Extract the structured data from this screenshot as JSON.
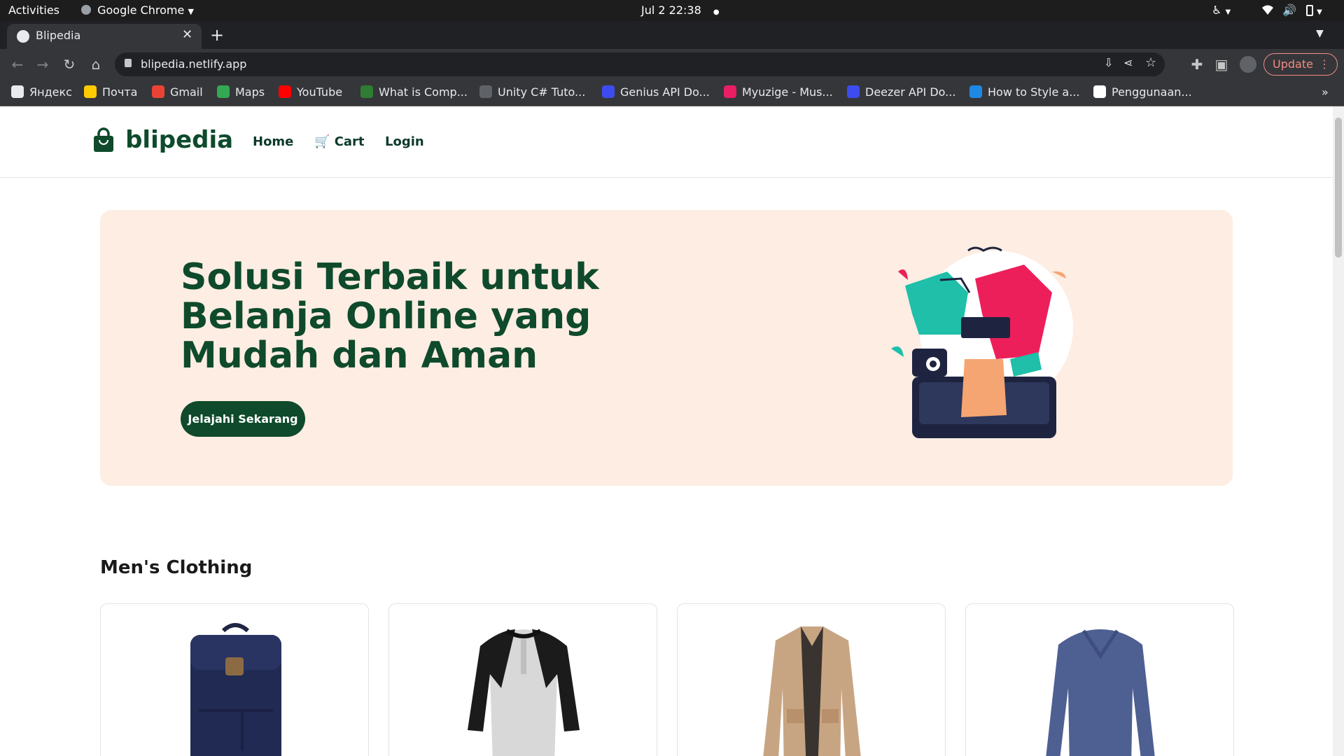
{
  "system_bar": {
    "activities": "Activities",
    "app_name": "Google Chrome",
    "datetime": "Jul 2  22:38"
  },
  "browser": {
    "tab_title": "Blipedia",
    "url": "blipedia.netlify.app",
    "update_label": "Update",
    "bookmarks": [
      {
        "label": "Яндекс",
        "color": "#e8eaed"
      },
      {
        "label": "Почта",
        "color": "#ffcc00"
      },
      {
        "label": "Gmail",
        "color": "#ea4335"
      },
      {
        "label": "Maps",
        "color": "#34a853"
      },
      {
        "label": "YouTube",
        "color": "#ff0000"
      },
      {
        "label": "What is Comp...",
        "color": "#2e7d32"
      },
      {
        "label": "Unity C# Tuto...",
        "color": "#5f6368"
      },
      {
        "label": "Genius API Do...",
        "color": "#3c4cf0"
      },
      {
        "label": "Myuzige - Mus...",
        "color": "#e91e63"
      },
      {
        "label": "Deezer API Do...",
        "color": "#3c4cf0"
      },
      {
        "label": "How to Style a...",
        "color": "#1e88e5"
      },
      {
        "label": "Penggunaan...",
        "color": "#ffffff"
      }
    ]
  },
  "site": {
    "logo_text": "blipedia",
    "nav": {
      "home": "Home",
      "cart": "Cart",
      "login": "Login"
    },
    "hero": {
      "title": "Solusi Terbaik untuk Belanja Online yang Mudah dan Aman",
      "cta": "Jelajahi Sekarang"
    },
    "section_title": "Men's Clothing",
    "products": [
      {
        "image": "backpack"
      },
      {
        "image": "raglan-tshirt"
      },
      {
        "image": "jacket"
      },
      {
        "image": "long-sleeve-shirt"
      }
    ]
  },
  "colors": {
    "brand_green": "#0e4a2b",
    "hero_bg": "#fdede3"
  }
}
